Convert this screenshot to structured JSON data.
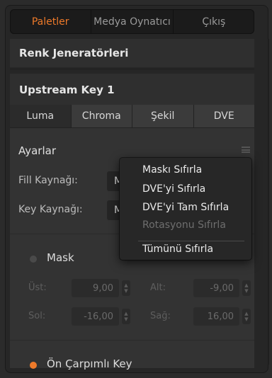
{
  "top_tabs": [
    "Paletler",
    "Medya Oynatıcı",
    "Çıkış"
  ],
  "sections": {
    "color_generators": "Renk Jeneratörleri",
    "upstream_key": "Upstream Key 1"
  },
  "sub_tabs": [
    "Luma",
    "Chroma",
    "Şekil",
    "DVE"
  ],
  "settings": {
    "title": "Ayarlar",
    "fill_label": "Fill Kaynağı:",
    "fill_value": "M",
    "key_label": "Key Kaynağı:",
    "key_value": "M"
  },
  "mask": {
    "label": "Mask",
    "top_label": "Üst:",
    "top_value": "9,00",
    "bottom_label": "Alt:",
    "bottom_value": "-9,00",
    "left_label": "Sol:",
    "left_value": "-16,00",
    "right_label": "Sağ:",
    "right_value": "16,00"
  },
  "premultiplied": {
    "label": "Ön Çarpımlı Key"
  },
  "context_menu": {
    "items": [
      "Maskı Sıfırla",
      "DVE'yi Sıfırla",
      "DVE'yi Tam Sıfırla",
      "Rotasyonu Sıfırla",
      "Tümünü Sıfırla"
    ]
  },
  "colors": {
    "accent": "#ee7a2a"
  }
}
